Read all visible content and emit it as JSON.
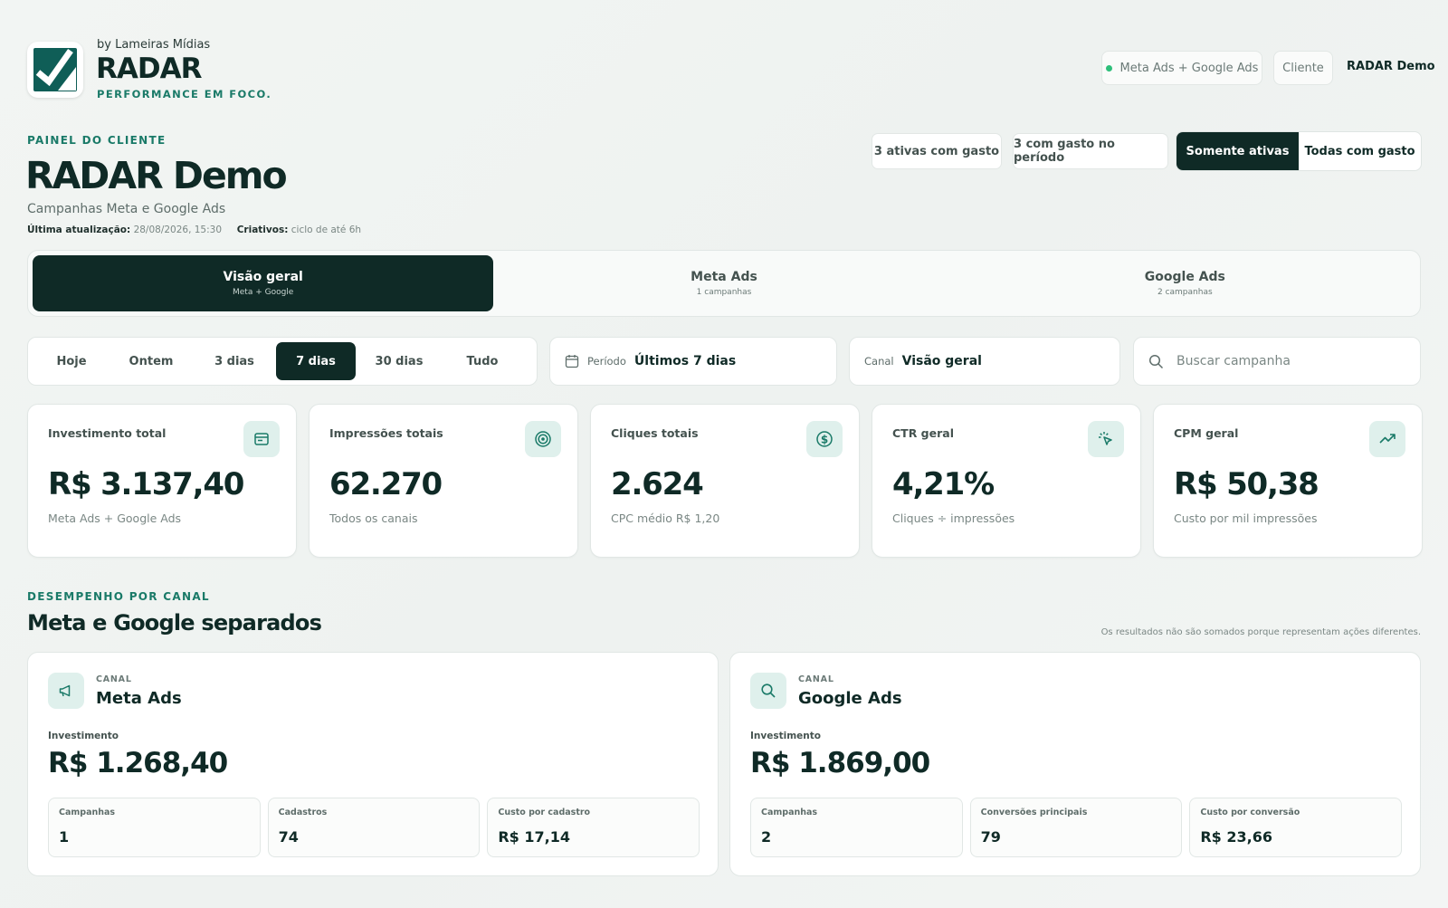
{
  "brand": {
    "by": "by Lameiras Mídias",
    "name": "RADAR",
    "tagline": "PERFORMANCE EM FOCO."
  },
  "topbar": {
    "channels_label": "Meta Ads + Google Ads",
    "client_label": "Cliente",
    "client_name": "RADAR Demo"
  },
  "header": {
    "eyebrow": "PAINEL DO CLIENTE",
    "title": "RADAR Demo",
    "subtitle": "Campanhas Meta e Google Ads",
    "updated_label": "Última atualização:",
    "updated_value": "28/08/2026, 15:30",
    "creatives_label": "Criativos:",
    "creatives_value": "ciclo de até 6h"
  },
  "filters": {
    "active_with_spend": "3 ativas com gasto",
    "spend_in_period": "3 com gasto no período",
    "toggle": [
      {
        "label": "Somente ativas",
        "active": true
      },
      {
        "label": "Todas com gasto",
        "active": false
      }
    ]
  },
  "tabs": [
    {
      "title": "Visão geral",
      "sub": "Meta + Google",
      "active": true
    },
    {
      "title": "Meta Ads",
      "sub": "1 campanhas",
      "active": false
    },
    {
      "title": "Google Ads",
      "sub": "2 campanhas",
      "active": false
    }
  ],
  "range": [
    {
      "label": "Hoje",
      "active": false
    },
    {
      "label": "Ontem",
      "active": false
    },
    {
      "label": "3 dias",
      "active": false
    },
    {
      "label": "7 dias",
      "active": true
    },
    {
      "label": "30 dias",
      "active": false
    },
    {
      "label": "Tudo",
      "active": false
    }
  ],
  "period": {
    "label": "Período",
    "value": "Últimos 7 dias"
  },
  "channel": {
    "label": "Canal",
    "value": "Visão geral"
  },
  "search": {
    "placeholder": "Buscar campanha"
  },
  "kpis": [
    {
      "label": "Investimento total",
      "value": "R$ 3.137,40",
      "sub": "Meta Ads + Google Ads",
      "icon": "wallet-icon"
    },
    {
      "label": "Impressões totais",
      "value": "62.270",
      "sub": "Todos os canais",
      "icon": "target-icon"
    },
    {
      "label": "Cliques totais",
      "value": "2.624",
      "sub": "CPC médio R$ 1,20",
      "icon": "dollar-icon"
    },
    {
      "label": "CTR geral",
      "value": "4,21%",
      "sub": "Cliques ÷ impressões",
      "icon": "click-icon"
    },
    {
      "label": "CPM geral",
      "value": "R$ 50,38",
      "sub": "Custo por mil impressões",
      "icon": "trend-up-icon"
    }
  ],
  "section": {
    "eyebrow": "DESEMPENHO POR CANAL",
    "title": "Meta e Google separados",
    "note": "Os resultados não são somados porque representam ações diferentes."
  },
  "channels": [
    {
      "eyebrow": "CANAL",
      "name": "Meta Ads",
      "icon": "megaphone-icon",
      "inv_label": "Investimento",
      "inv": "R$ 1.268,40",
      "stats": [
        {
          "label": "Campanhas",
          "value": "1"
        },
        {
          "label": "Cadastros",
          "value": "74"
        },
        {
          "label": "Custo por cadastro",
          "value": "R$ 17,14"
        }
      ]
    },
    {
      "eyebrow": "CANAL",
      "name": "Google Ads",
      "icon": "search-icon",
      "inv_label": "Investimento",
      "inv": "R$ 1.869,00",
      "stats": [
        {
          "label": "Campanhas",
          "value": "2"
        },
        {
          "label": "Conversões principais",
          "value": "79"
        },
        {
          "label": "Custo por conversão",
          "value": "R$ 23,66"
        }
      ]
    }
  ],
  "colors": {
    "accent": "#1a7a68",
    "dark": "#0f2a26",
    "icon_bg": "#dff0ec",
    "status_dot": "#2ebf7a"
  }
}
